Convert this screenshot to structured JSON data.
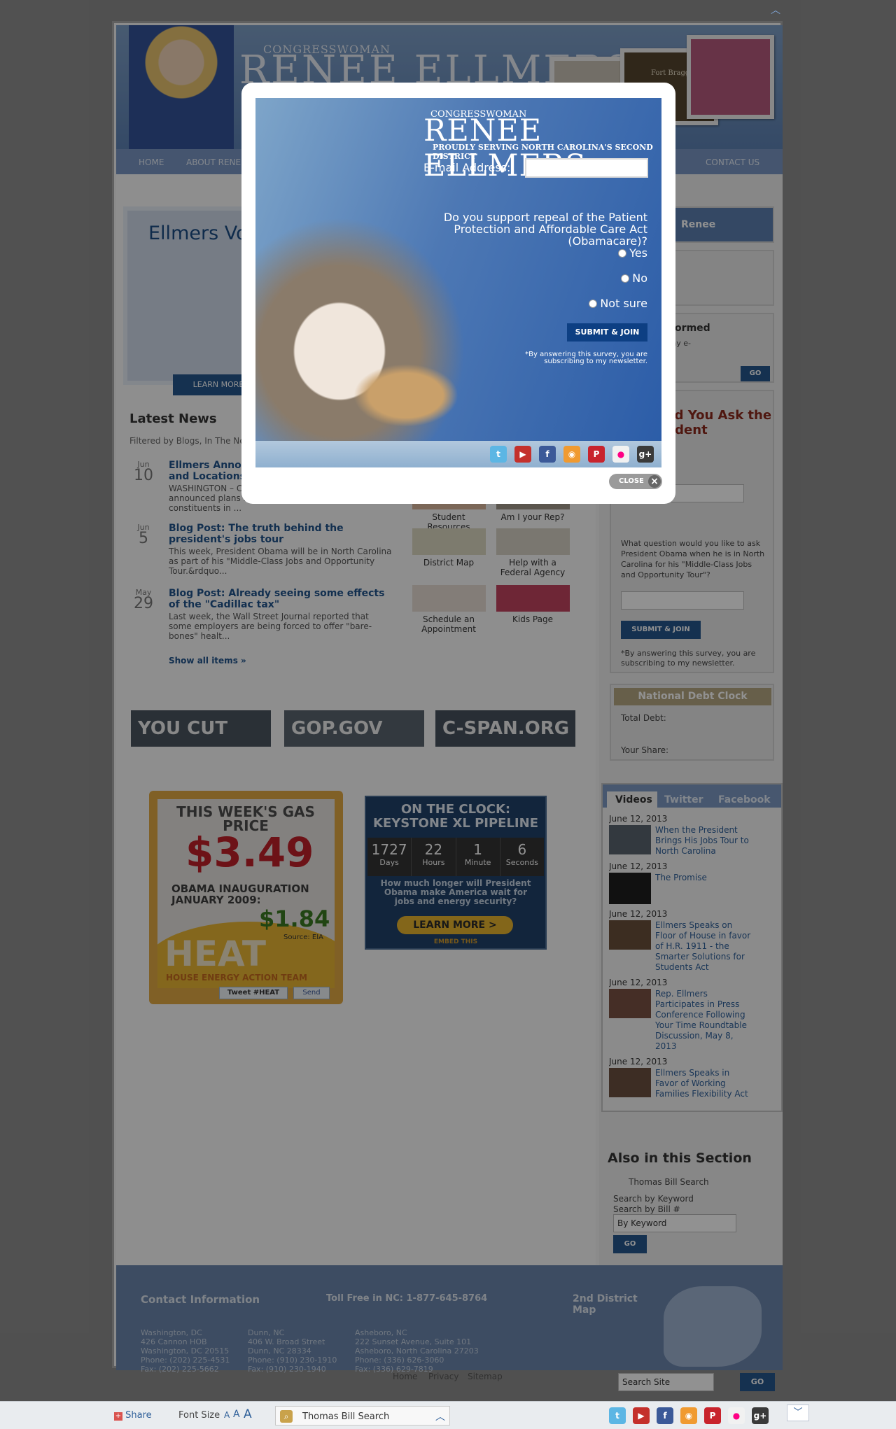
{
  "header": {
    "small_title": "CONGRESSWOMAN",
    "name": "RENEE ELLMERS",
    "photo_caption": "Fort Bragg"
  },
  "nav": {
    "home": "HOME",
    "about": "ABOUT RENEE",
    "contact": "CONTACT US"
  },
  "featured": {
    "title": "Ellmers Votes to Repeal of Obamacare",
    "learn_more": "LEARN MORE"
  },
  "latest_news": {
    "heading": "Latest News",
    "filter": "Filtered by Blogs, In The News",
    "items": [
      {
        "month": "Jun",
        "day": "10",
        "title": "Ellmers Announces District Office Hours and Locations",
        "excerpt": "WASHINGTON – Congresswoman Renee Ellmers announced plans for mobile office hours for constituents in ..."
      },
      {
        "month": "Jun",
        "day": "5",
        "title": "Blog Post: The truth behind the president's jobs tour",
        "excerpt": "This week, President Obama will be in North Carolina as part of his \"Middle-Class Jobs and Opportunity Tour.&rdquo..."
      },
      {
        "month": "May",
        "day": "29",
        "title": "Blog Post: Already seeing some effects of the \"Cadillac tax\"",
        "excerpt": "Last week, the Wall Street Journal reported that some employers are being forced to offer \"bare-bones\" healt..."
      }
    ],
    "show_all": "Show all items »"
  },
  "quick_links": {
    "student": "Student Resources",
    "rep": "Am I your Rep?",
    "map": "District Map",
    "agency": "Help with a Federal Agency",
    "appointment": "Schedule an Appointment",
    "kids": "Kids Page"
  },
  "banners": {
    "youcut": "YOU CUT",
    "gop": "GOP.GOV",
    "cspan": "C-SPAN.ORG"
  },
  "gas": {
    "title": "THIS WEEK'S GAS PRICE",
    "price": "$3.49",
    "inauguration": "OBAMA INAUGURATION JANUARY 2009:",
    "old_price": "$1.84",
    "source": "Source: EIA",
    "heat": "HEAT",
    "team": "HOUSE ENERGY ACTION TEAM",
    "tweet": "Tweet #HEAT",
    "send": "Send"
  },
  "clock": {
    "title": "ON THE CLOCK: KEYSTONE XL PIPELINE",
    "days": "1727",
    "days_label": "Days",
    "hours": "22",
    "hours_label": "Hours",
    "minutes": "1",
    "minutes_label": "Minute",
    "seconds": "6",
    "seconds_label": "Seconds",
    "question": "How much longer will President Obama make America wait for jobs and energy security?",
    "learn": "LEARN MORE >",
    "embed": "EMBED THIS"
  },
  "sidebar": {
    "renee": "Renee",
    "newsletter_head": "Stay Informed",
    "newsletter_text": "E-mail to my e-Newsletter",
    "go": "GO",
    "survey_head": "Would You Ask the President",
    "survey_question": "What question would you like to ask President Obama when he is in North Carolina for his \"Middle-Class Jobs and Opportunity Tour\"?",
    "survey_submit": "SUBMIT & JOIN",
    "survey_disclaimer": "*By answering this survey, you are subscribing to my newsletter.",
    "debt_title": "National Debt Clock",
    "total_debt": "Total Debt:",
    "your_share": "Your Share:",
    "tabs": [
      "Videos",
      "Twitter",
      "Facebook"
    ],
    "videos": [
      {
        "date": "June 12, 2013",
        "title": "When the President Brings His Jobs Tour to North Carolina"
      },
      {
        "date": "June 12, 2013",
        "title": "The Promise"
      },
      {
        "date": "June 12, 2013",
        "title": "Ellmers Speaks on Floor of House in favor of H.R. 1911 - the Smarter Solutions for Students Act"
      },
      {
        "date": "June 12, 2013",
        "title": "Rep. Ellmers Participates in Press Conference Following Your Time Roundtable Discussion, May 8, 2013"
      },
      {
        "date": "June 12, 2013",
        "title": "Ellmers Speaks in Favor of Working Families Flexibility Act"
      }
    ],
    "also_heading": "Also in this Section",
    "thomas": "Thomas Bill Search",
    "search_keyword": "Search by Keyword",
    "search_bill": "Search by Bill #",
    "keyword_value": "By Keyword",
    "go2": "GO"
  },
  "footer": {
    "contact_title": "Contact Information",
    "toll_free": "Toll Free in NC: 1-877-645-8764",
    "district_map": "2nd District Map",
    "dc": "Washington, DC\n426 Cannon HOB\nWashington, DC 20515\nPhone: (202) 225-4531\nFax: (202) 225-5662",
    "dunn": "Dunn, NC\n406 W. Broad Street\nDunn, NC 28334\nPhone: (910) 230-1910\nFax: (910) 230-1940",
    "asheboro": "Asheboro, NC\n222 Sunset Avenue, Suite 101\nAsheboro, North Carolina 27203\nPhone: (336) 626-3060\nFax: (336) 629-7819",
    "home": "Home",
    "privacy": "Privacy",
    "sitemap": "Sitemap",
    "search_placeholder": "Search Site",
    "go": "GO"
  },
  "modal": {
    "small_title": "CONGRESSWOMAN",
    "name": "RENEE ELLMERS",
    "tagline": "PROUDLY SERVING NORTH CAROLINA'S SECOND DISTRICT",
    "email_label": "E-mail Address:",
    "question": "Do you support repeal of the Patient Protection and Affordable Care Act (Obamacare)?",
    "options": [
      "Yes",
      "No",
      "Not sure"
    ],
    "submit": "SUBMIT & JOIN",
    "disclaimer": "*By answering this survey, you are subscribing to my newsletter.",
    "close": "CLOSE"
  },
  "bottom_bar": {
    "share": "Share",
    "font_size": "Font Size",
    "font_a_small": "A",
    "font_a_medium": "A",
    "font_a_large": "A",
    "thomas": "Thomas Bill Search"
  },
  "social_icons": [
    "twitter-icon",
    "youtube-icon",
    "facebook-icon",
    "rss-icon",
    "pinterest-icon",
    "flickr-icon",
    "googleplus-icon"
  ]
}
